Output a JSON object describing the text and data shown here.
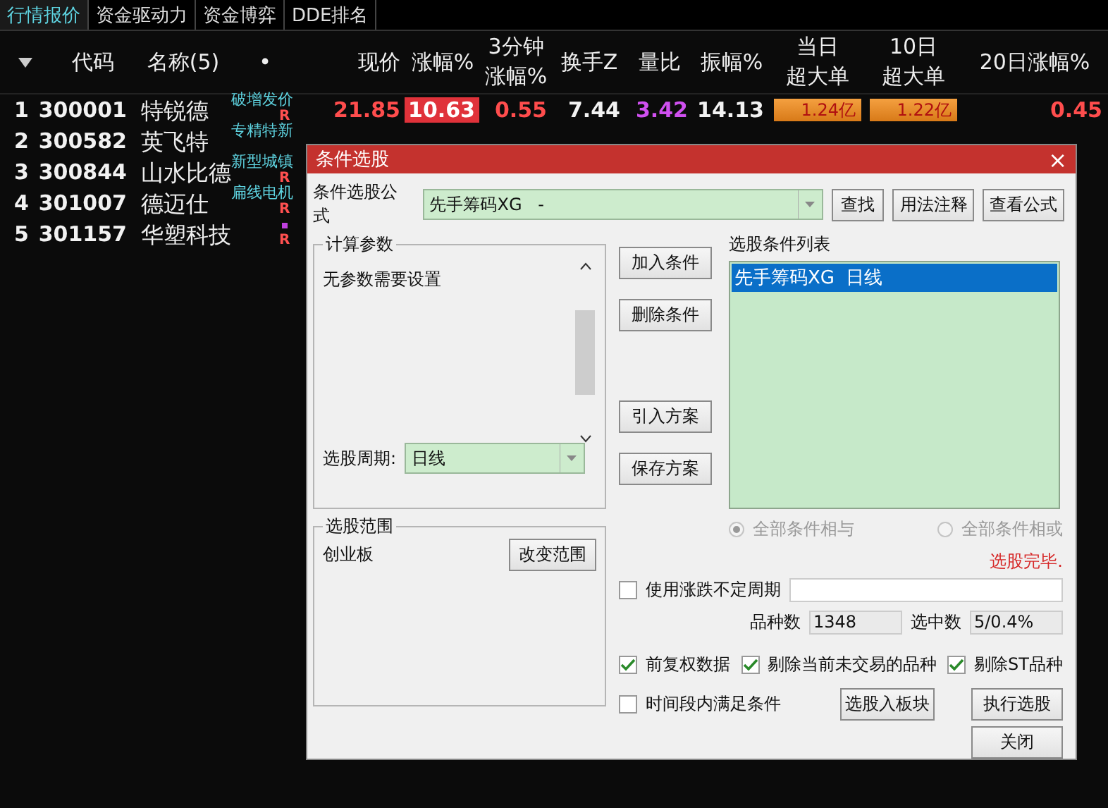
{
  "tabs": [
    {
      "label": "行情报价",
      "selected": true
    },
    {
      "label": "资金驱动力",
      "selected": false
    },
    {
      "label": "资金博弈",
      "selected": false
    },
    {
      "label": "DDE排名",
      "selected": false
    }
  ],
  "table": {
    "columns": [
      {
        "lines": [
          "代码"
        ]
      },
      {
        "lines": [
          "名称(5)"
        ]
      },
      {
        "lines": [
          "•"
        ]
      },
      {
        "lines": [
          "现价"
        ]
      },
      {
        "lines": [
          "涨幅%"
        ]
      },
      {
        "lines": [
          "3分钟",
          "涨幅%"
        ]
      },
      {
        "lines": [
          "换手Z"
        ]
      },
      {
        "lines": [
          "量比"
        ]
      },
      {
        "lines": [
          "振幅%"
        ]
      },
      {
        "lines": [
          "当日",
          "超大单"
        ]
      },
      {
        "lines": [
          "10日",
          "超大单"
        ]
      },
      {
        "lines": [
          "20日涨幅%"
        ]
      }
    ],
    "rows": [
      {
        "rank": "1",
        "code": "300001",
        "name": "特锐德",
        "tag": "破增发价",
        "mark": "R",
        "flagged": false,
        "values": [
          "21.85",
          "10.63",
          "0.55",
          "7.44",
          "3.42",
          "14.13",
          "1.24亿",
          "1.22亿",
          "0.45"
        ]
      },
      {
        "rank": "2",
        "code": "300582",
        "name": "英飞特",
        "tag": "专精特新",
        "flagged": false
      },
      {
        "rank": "3",
        "code": "300844",
        "name": "山水比德",
        "tag": "新型城镇",
        "mark": "R",
        "flagged": false
      },
      {
        "rank": "4",
        "code": "301007",
        "name": "德迈仕",
        "tag": "扁线电机",
        "mark": "R",
        "flagged": false
      },
      {
        "rank": "5",
        "code": "301157",
        "name": "华塑科技",
        "mark": "R",
        "flagged": true
      }
    ]
  },
  "dialog": {
    "title": "条件选股",
    "close": "×",
    "formula": {
      "label": "条件选股公式",
      "value": "先手筹码XG   -"
    },
    "formula_buttons": [
      "查找",
      "用法注释",
      "查看公式"
    ],
    "params": {
      "title": "计算参数",
      "text": "无参数需要设置",
      "period_label": "选股周期:",
      "period_value": "日线"
    },
    "condition_buttons": [
      "加入条件",
      "删除条件",
      "引入方案",
      "保存方案"
    ],
    "list": {
      "title": "选股条件列表",
      "items": [
        {
          "label": "先手筹码XG  日线",
          "selected": true
        }
      ]
    },
    "radios": [
      {
        "label": "全部条件相与",
        "selected": true,
        "disabled": true
      },
      {
        "label": "全部条件相或",
        "selected": false,
        "disabled": true
      }
    ],
    "status": "选股完毕.",
    "range": {
      "title": "选股范围",
      "value": "创业板",
      "button": "改变范围"
    },
    "period_option": {
      "label": "使用涨跌不定周期",
      "checked": false
    },
    "counts": [
      {
        "label": "品种数",
        "value": "1348"
      },
      {
        "label": "选中数",
        "value": "5/0.4%"
      }
    ],
    "options": [
      {
        "label": "前复权数据",
        "checked": true
      },
      {
        "label": "剔除当前未交易的品种",
        "checked": true
      },
      {
        "label": "剔除ST品种",
        "checked": true
      }
    ],
    "timespan_option": {
      "label": "时间段内满足条件",
      "checked": false
    },
    "action_buttons": [
      "选股入板块",
      "执行选股"
    ],
    "close_button": "关闭"
  }
}
